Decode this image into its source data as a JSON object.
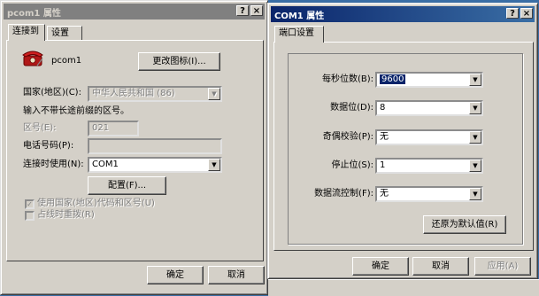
{
  "left_window": {
    "title": "pcom1 属性",
    "tabs": [
      "连接到",
      "设置"
    ],
    "icon_label": "pcom1",
    "change_icon_button": "更改图标(I)...",
    "country_label": "国家(地区)(C):",
    "country_value": "中华人民共和国 (86)",
    "hint": "输入不带长途前缀的区号。",
    "area_label": "区号(E):",
    "area_value": "021",
    "phone_label": "电话号码(P):",
    "phone_value": "",
    "connect_label": "连接时使用(N):",
    "connect_value": "COM1",
    "config_button": "配置(F)...",
    "use_country_check": "使用国家(地区)代码和区号(U)",
    "redial_check": "占线时重拨(R)",
    "ok_button": "确定",
    "cancel_button": "取消"
  },
  "right_window": {
    "title": "COM1 属性",
    "tabs": [
      "端口设置"
    ],
    "rows": [
      {
        "label": "每秒位数(B):",
        "value": "9600"
      },
      {
        "label": "数据位(D):",
        "value": "8"
      },
      {
        "label": "奇偶校验(P):",
        "value": "无"
      },
      {
        "label": "停止位(S):",
        "value": "1"
      },
      {
        "label": "数据流控制(F):",
        "value": "无"
      }
    ],
    "restore_button": "还原为默认值(R)",
    "ok_button": "确定",
    "cancel_button": "取消",
    "apply_button": "应用(A)"
  },
  "titlebar_buttons": {
    "help": "?",
    "close": "×"
  }
}
